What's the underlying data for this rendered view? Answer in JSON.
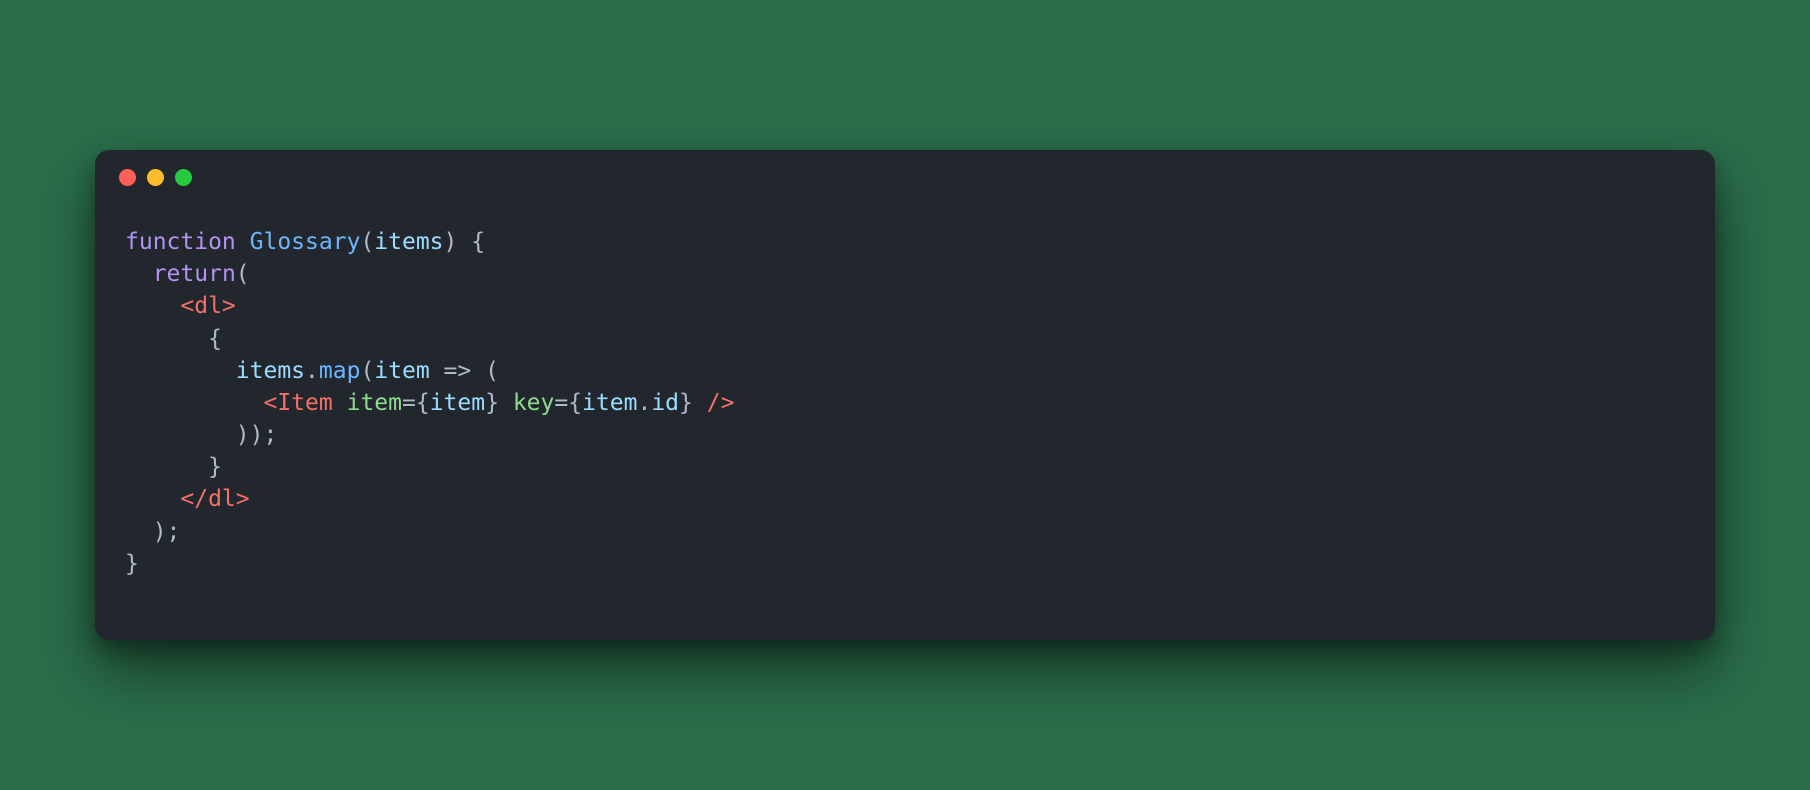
{
  "code": {
    "line1": {
      "function_keyword": "function",
      "function_name": "Glossary",
      "paren_open": "(",
      "param": "items",
      "paren_close_brace": ") {"
    },
    "line2": {
      "indent": "  ",
      "return_keyword": "return",
      "paren": "("
    },
    "line3": {
      "indent": "    ",
      "tag": "<dl>"
    },
    "line4": {
      "indent": "      ",
      "brace": "{"
    },
    "line5": {
      "indent": "        ",
      "items": "items",
      "dot": ".",
      "map": "map",
      "open": "(",
      "item_param": "item",
      "arrow": " => ("
    },
    "line6": {
      "indent": "          ",
      "open_tag": "<",
      "component": "Item",
      "space1": " ",
      "attr1": "item",
      "eq1": "=",
      "brace1_open": "{",
      "val1": "item",
      "brace1_close": "}",
      "space2": " ",
      "attr2": "key",
      "eq2": "=",
      "brace2_open": "{",
      "val2a": "item",
      "val2_dot": ".",
      "val2b": "id",
      "brace2_close": "}",
      "close_tag": " />"
    },
    "line7": {
      "indent": "        ",
      "content": "));"
    },
    "line8": {
      "indent": "      ",
      "brace": "}"
    },
    "line9": {
      "indent": "    ",
      "tag": "</dl>"
    },
    "line10": {
      "indent": "  ",
      "content": ");"
    },
    "line11": {
      "content": "}"
    }
  }
}
